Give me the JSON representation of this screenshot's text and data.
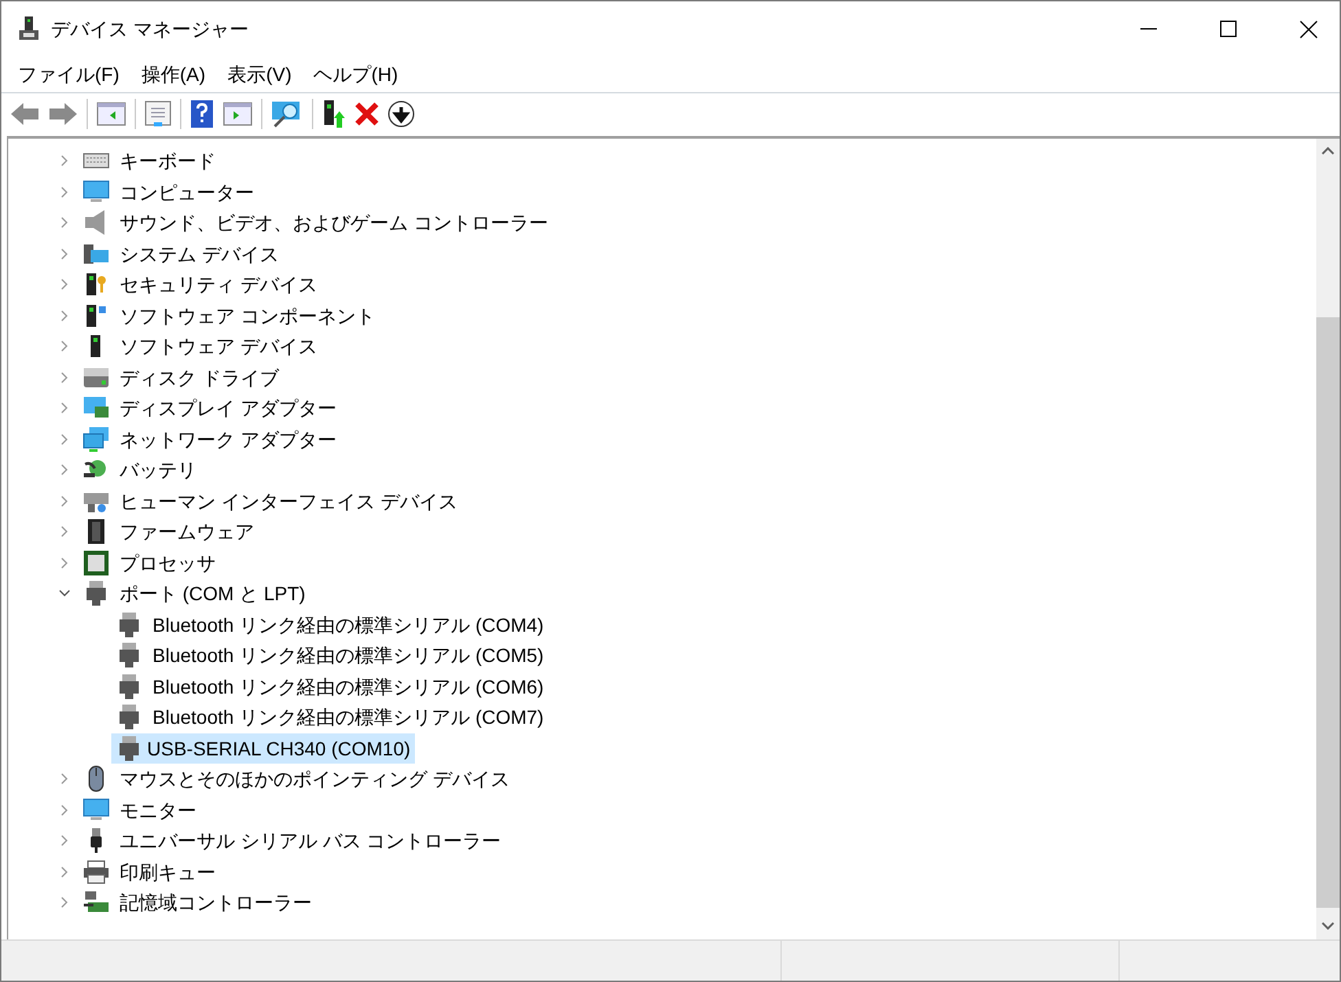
{
  "window": {
    "title": "デバイス マネージャー"
  },
  "menu": [
    "ファイル(F)",
    "操作(A)",
    "表示(V)",
    "ヘルプ(H)"
  ],
  "tree": [
    {
      "label": "キーボード",
      "expanded": false,
      "selected": false
    },
    {
      "label": "コンピューター",
      "expanded": false,
      "selected": false
    },
    {
      "label": "サウンド、ビデオ、およびゲーム コントローラー",
      "expanded": false,
      "selected": false
    },
    {
      "label": "システム デバイス",
      "expanded": false,
      "selected": false
    },
    {
      "label": "セキュリティ デバイス",
      "expanded": false,
      "selected": false
    },
    {
      "label": "ソフトウェア コンポーネント",
      "expanded": false,
      "selected": false
    },
    {
      "label": "ソフトウェア デバイス",
      "expanded": false,
      "selected": false
    },
    {
      "label": "ディスク ドライブ",
      "expanded": false,
      "selected": false
    },
    {
      "label": "ディスプレイ アダプター",
      "expanded": false,
      "selected": false
    },
    {
      "label": "ネットワーク アダプター",
      "expanded": false,
      "selected": false
    },
    {
      "label": "バッテリ",
      "expanded": false,
      "selected": false
    },
    {
      "label": "ヒューマン インターフェイス デバイス",
      "expanded": false,
      "selected": false
    },
    {
      "label": "ファームウェア",
      "expanded": false,
      "selected": false
    },
    {
      "label": "プロセッサ",
      "expanded": false,
      "selected": false
    },
    {
      "label": "ポート (COM と LPT)",
      "expanded": true,
      "selected": false,
      "children": [
        {
          "label": "Bluetooth リンク経由の標準シリアル (COM4)",
          "selected": false
        },
        {
          "label": "Bluetooth リンク経由の標準シリアル (COM5)",
          "selected": false
        },
        {
          "label": "Bluetooth リンク経由の標準シリアル (COM6)",
          "selected": false
        },
        {
          "label": "Bluetooth リンク経由の標準シリアル (COM7)",
          "selected": false
        },
        {
          "label": "USB-SERIAL CH340 (COM10)",
          "selected": true
        }
      ]
    },
    {
      "label": "マウスとそのほかのポインティング デバイス",
      "expanded": false,
      "selected": false
    },
    {
      "label": "モニター",
      "expanded": false,
      "selected": false
    },
    {
      "label": "ユニバーサル シリアル バス コントローラー",
      "expanded": false,
      "selected": false
    },
    {
      "label": "印刷キュー",
      "expanded": false,
      "selected": false
    },
    {
      "label": "記憶域コントローラー",
      "expanded": false,
      "selected": false
    }
  ]
}
